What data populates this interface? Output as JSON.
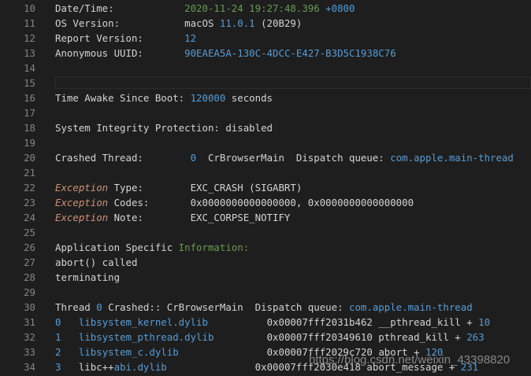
{
  "colors": {
    "text": "#d4d4d4",
    "line_number": "#858585",
    "number": "#b5cea8",
    "blue": "#569cd6",
    "keyword": "#ce9178",
    "green": "#6a9955",
    "background": "#1e1e1e"
  },
  "lines": [
    {
      "num": "10",
      "segments": [
        {
          "text": "Date/Time:            ",
          "color": "text"
        },
        {
          "text": "2020-11-24 19:27:48.396 ",
          "color": "green"
        },
        {
          "text": "+0800",
          "color": "blue"
        }
      ]
    },
    {
      "num": "11",
      "segments": [
        {
          "text": "OS Version:           macOS ",
          "color": "text"
        },
        {
          "text": "11.0.1",
          "color": "blue"
        },
        {
          "text": " (20B29)",
          "color": "text"
        }
      ]
    },
    {
      "num": "12",
      "segments": [
        {
          "text": "Report Version:       ",
          "color": "text"
        },
        {
          "text": "12",
          "color": "blue"
        }
      ]
    },
    {
      "num": "13",
      "segments": [
        {
          "text": "Anonymous UUID:       ",
          "color": "text"
        },
        {
          "text": "90EAEA5A-130C-4DCC-E427-B3D5C1938C76",
          "color": "blue"
        }
      ]
    },
    {
      "num": "14",
      "segments": []
    },
    {
      "num": "15",
      "segments": [],
      "current": true
    },
    {
      "num": "16",
      "segments": [
        {
          "text": "Time Awake Since Boot: ",
          "color": "text"
        },
        {
          "text": "120000",
          "color": "blue"
        },
        {
          "text": " seconds",
          "color": "text"
        }
      ]
    },
    {
      "num": "17",
      "segments": []
    },
    {
      "num": "18",
      "segments": [
        {
          "text": "System Integrity Protection: disabled",
          "color": "text"
        }
      ]
    },
    {
      "num": "19",
      "segments": []
    },
    {
      "num": "20",
      "segments": [
        {
          "text": "Crashed Thread:        ",
          "color": "text"
        },
        {
          "text": "0",
          "color": "blue"
        },
        {
          "text": "  CrBrowserMain  Dispatch queue: ",
          "color": "text"
        },
        {
          "text": "com.apple.main-thread",
          "color": "blue"
        }
      ]
    },
    {
      "num": "21",
      "segments": []
    },
    {
      "num": "22",
      "segments": [
        {
          "text": "Exception",
          "color": "keyword",
          "italic": true
        },
        {
          "text": " Type:        EXC_CRASH (SIGABRT)",
          "color": "text"
        }
      ]
    },
    {
      "num": "23",
      "segments": [
        {
          "text": "Exception",
          "color": "keyword",
          "italic": true
        },
        {
          "text": " Codes:       0x0000000000000000, 0x0000000000000000",
          "color": "text"
        }
      ]
    },
    {
      "num": "24",
      "segments": [
        {
          "text": "Exception",
          "color": "keyword",
          "italic": true
        },
        {
          "text": " Note:        EXC_CORPSE_NOTIFY",
          "color": "text"
        }
      ]
    },
    {
      "num": "25",
      "segments": []
    },
    {
      "num": "26",
      "segments": [
        {
          "text": "Application Specific ",
          "color": "text"
        },
        {
          "text": "Information:",
          "color": "green"
        }
      ]
    },
    {
      "num": "27",
      "segments": [
        {
          "text": "abort() called",
          "color": "text"
        }
      ]
    },
    {
      "num": "28",
      "segments": [
        {
          "text": "terminating",
          "color": "text"
        }
      ]
    },
    {
      "num": "29",
      "segments": []
    },
    {
      "num": "30",
      "segments": [
        {
          "text": "Thread ",
          "color": "text"
        },
        {
          "text": "0",
          "color": "blue"
        },
        {
          "text": " Crashed:: CrBrowserMain  Dispatch queue: ",
          "color": "text"
        },
        {
          "text": "com.apple.main-thread",
          "color": "blue"
        }
      ]
    },
    {
      "num": "31",
      "segments": [
        {
          "text": "0",
          "color": "blue"
        },
        {
          "text": "   ",
          "color": "text"
        },
        {
          "text": "libsystem_kernel.dylib",
          "color": "blue"
        },
        {
          "text": "          0x00007fff2031b462 __pthread_kill + ",
          "color": "text"
        },
        {
          "text": "10",
          "color": "blue"
        }
      ]
    },
    {
      "num": "32",
      "segments": [
        {
          "text": "1",
          "color": "blue"
        },
        {
          "text": "   ",
          "color": "text"
        },
        {
          "text": "libsystem_pthread.dylib",
          "color": "blue"
        },
        {
          "text": "         0x00007fff20349610 pthread_kill + ",
          "color": "text"
        },
        {
          "text": "263",
          "color": "blue"
        }
      ]
    },
    {
      "num": "33",
      "segments": [
        {
          "text": "2",
          "color": "blue"
        },
        {
          "text": "   ",
          "color": "text"
        },
        {
          "text": "libsystem_c.dylib",
          "color": "blue"
        },
        {
          "text": "               0x00007fff2029c720 abort + ",
          "color": "text"
        },
        {
          "text": "120",
          "color": "blue"
        }
      ]
    },
    {
      "num": "34",
      "segments": [
        {
          "text": "3",
          "color": "blue"
        },
        {
          "text": "   libc++",
          "color": "text"
        },
        {
          "text": "abi.dylib",
          "color": "blue"
        },
        {
          "text": "               0x00007fff2030e418 abort_message + ",
          "color": "text"
        },
        {
          "text": "231",
          "color": "blue"
        }
      ]
    }
  ],
  "watermark": "https://blog.csdn.net/weixin_43398820"
}
